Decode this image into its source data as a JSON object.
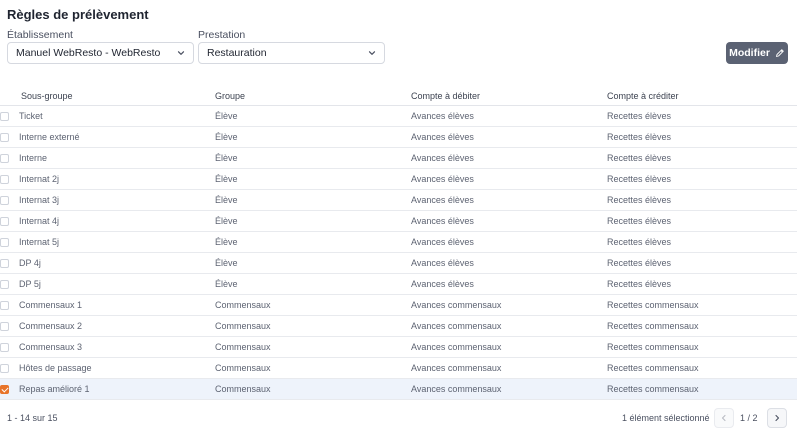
{
  "page": {
    "title": "Règles de prélèvement"
  },
  "filters": {
    "etablissement": {
      "label": "Établissement",
      "value": "Manuel WebResto - WebResto"
    },
    "prestation": {
      "label": "Prestation",
      "value": "Restauration"
    }
  },
  "toolbar": {
    "modify_label": "Modifier"
  },
  "table": {
    "headers": [
      "Sous-groupe",
      "Groupe",
      "Compte à débiter",
      "Compte à créditer"
    ],
    "rows": [
      {
        "sous_groupe": "Ticket",
        "groupe": "Élève",
        "debit": "Avances élèves",
        "credit": "Recettes élèves",
        "checked": false
      },
      {
        "sous_groupe": "Interne externé",
        "groupe": "Élève",
        "debit": "Avances élèves",
        "credit": "Recettes élèves",
        "checked": false
      },
      {
        "sous_groupe": "Interne",
        "groupe": "Élève",
        "debit": "Avances élèves",
        "credit": "Recettes élèves",
        "checked": false
      },
      {
        "sous_groupe": "Internat 2j",
        "groupe": "Élève",
        "debit": "Avances élèves",
        "credit": "Recettes élèves",
        "checked": false
      },
      {
        "sous_groupe": "Internat 3j",
        "groupe": "Élève",
        "debit": "Avances élèves",
        "credit": "Recettes élèves",
        "checked": false
      },
      {
        "sous_groupe": "Internat 4j",
        "groupe": "Élève",
        "debit": "Avances élèves",
        "credit": "Recettes élèves",
        "checked": false
      },
      {
        "sous_groupe": "Internat 5j",
        "groupe": "Élève",
        "debit": "Avances élèves",
        "credit": "Recettes élèves",
        "checked": false
      },
      {
        "sous_groupe": "DP 4j",
        "groupe": "Élève",
        "debit": "Avances élèves",
        "credit": "Recettes élèves",
        "checked": false
      },
      {
        "sous_groupe": "DP 5j",
        "groupe": "Élève",
        "debit": "Avances élèves",
        "credit": "Recettes élèves",
        "checked": false
      },
      {
        "sous_groupe": "Commensaux 1",
        "groupe": "Commensaux",
        "debit": "Avances commensaux",
        "credit": "Recettes commensaux",
        "checked": false
      },
      {
        "sous_groupe": "Commensaux 2",
        "groupe": "Commensaux",
        "debit": "Avances commensaux",
        "credit": "Recettes commensaux",
        "checked": false
      },
      {
        "sous_groupe": "Commensaux 3",
        "groupe": "Commensaux",
        "debit": "Avances commensaux",
        "credit": "Recettes commensaux",
        "checked": false
      },
      {
        "sous_groupe": "Hôtes de passage",
        "groupe": "Commensaux",
        "debit": "Avances commensaux",
        "credit": "Recettes commensaux",
        "checked": false
      },
      {
        "sous_groupe": "Repas amélioré 1",
        "groupe": "Commensaux",
        "debit": "Avances commensaux",
        "credit": "Recettes commensaux",
        "checked": true
      }
    ]
  },
  "footer": {
    "count": "1 - 14 sur 15",
    "selected": "1 élément sélectionné",
    "page": "1 / 2"
  },
  "colors": {
    "accent": "#e8742a",
    "button": "#5b6273",
    "selected_row": "#eef3fb"
  },
  "icons": {
    "dropdown": "chevron-down-icon",
    "edit": "pencil-icon",
    "prev": "chevron-left-icon",
    "next": "chevron-right-icon"
  }
}
